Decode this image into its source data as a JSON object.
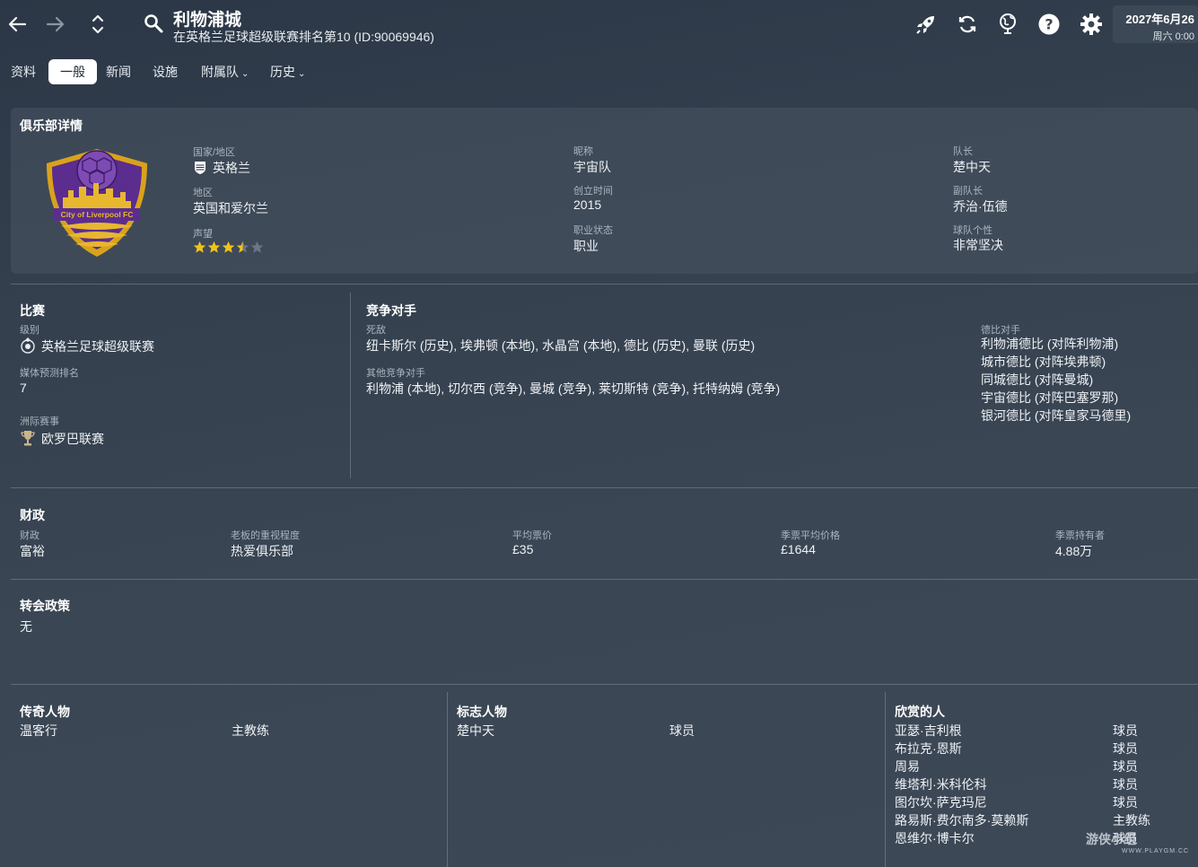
{
  "header": {
    "title": "利物浦城",
    "subtitle": "在英格兰足球超级联赛排名第10 (ID:90069946)",
    "date": "2027年6月26",
    "day_time": "周六 0:00"
  },
  "tabs": [
    {
      "label": "资料"
    },
    {
      "label": "一般"
    },
    {
      "label": "新闻"
    },
    {
      "label": "设施"
    },
    {
      "label": "附属队"
    },
    {
      "label": "历史"
    }
  ],
  "club_details": {
    "heading": "俱乐部详情",
    "badge_text": "City of Liverpool FC",
    "country_label": "国家/地区",
    "country": "英格兰",
    "region_label": "地区",
    "region": "英国和爱尔兰",
    "reputation_label": "声望",
    "reputation_stars": 3.5,
    "reputation_max": 5,
    "nickname_label": "昵称",
    "nickname": "宇宙队",
    "founded_label": "创立时间",
    "founded": "2015",
    "status_label": "职业状态",
    "status": "职业",
    "captain_label": "队长",
    "captain": "楚中天",
    "vice_captain_label": "副队长",
    "vice_captain": "乔治·伍德",
    "personality_label": "球队个性",
    "personality": "非常坚决"
  },
  "competition": {
    "heading": "比赛",
    "division_label": "级别",
    "division": "英格兰足球超级联赛",
    "media_label": "媒体预测排名",
    "media": "7",
    "continental_label": "洲际赛事",
    "continental": "欧罗巴联赛"
  },
  "rivals": {
    "heading": "竞争对手",
    "arch_label": "死敌",
    "arch": "纽卡斯尔 (历史), 埃弗顿 (本地), 水晶宫 (本地), 德比 (历史), 曼联 (历史)",
    "other_label": "其他竞争对手",
    "other": "利物浦 (本地), 切尔西 (竞争), 曼城 (竞争), 莱切斯特 (竞争), 托特纳姆 (竞争)",
    "derby_label": "德比对手",
    "derbies": [
      "利物浦德比 (对阵利物浦)",
      "城市德比 (对阵埃弗顿)",
      "同城德比 (对阵曼城)",
      "宇宙德比 (对阵巴塞罗那)",
      "银河德比 (对阵皇家马德里)"
    ]
  },
  "finances": {
    "heading": "财政",
    "items": [
      {
        "label": "财政",
        "value": "富裕"
      },
      {
        "label": "老板的重视程度",
        "value": "热爱俱乐部"
      },
      {
        "label": "平均票价",
        "value": "£35"
      },
      {
        "label": "季票平均价格",
        "value": "£1644"
      },
      {
        "label": "季票持有者",
        "value": "4.88万"
      }
    ]
  },
  "transfer_policy": {
    "heading": "转会政策",
    "value": "无"
  },
  "legends": {
    "heading": "传奇人物",
    "rows": [
      {
        "name": "温客行",
        "role": "主教练"
      }
    ]
  },
  "icons": {
    "heading": "标志人物",
    "rows": [
      {
        "name": "楚中天",
        "role": "球员"
      }
    ]
  },
  "admirers": {
    "heading": "欣赏的人",
    "rows": [
      {
        "name": "亚瑟·吉利根",
        "role": "球员"
      },
      {
        "name": "布拉克·恩斯",
        "role": "球员"
      },
      {
        "name": "周易",
        "role": "球员"
      },
      {
        "name": "维塔利·米科伦科",
        "role": "球员"
      },
      {
        "name": "图尔坎·萨克玛尼",
        "role": "球员"
      },
      {
        "name": "路易斯·费尔南多·莫赖斯",
        "role": "主教练"
      },
      {
        "name": "恩维尔·博卡尔",
        "role": "球员"
      }
    ]
  },
  "watermark": {
    "text": "游侠小组",
    "sub": "WWW.PLAYGM.CC"
  },
  "colors": {
    "accent_purple": "#5b2d8e",
    "gold": "#d9a21b",
    "star": "#f1c21b"
  }
}
